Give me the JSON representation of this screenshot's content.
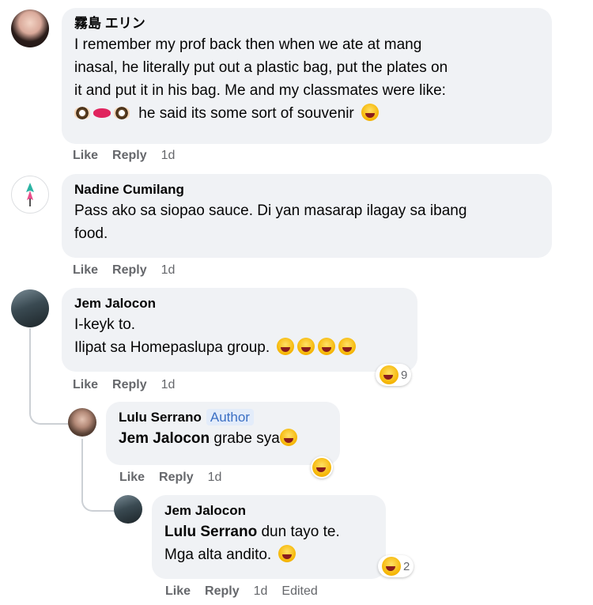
{
  "comments": [
    {
      "author": "霧島 エリン",
      "lines": [
        "I remember my prof back then when we ate at mang",
        "inasal, he literally put out a plastic bag, put the plates on",
        "it and put it in his bag. Me and my classmates were like:",
        "he said its some sort of souvenir"
      ],
      "actions": {
        "like": "Like",
        "reply": "Reply",
        "time": "1d"
      }
    },
    {
      "author": "Nadine Cumilang",
      "lines": [
        "Pass ako sa siopao sauce. Di yan masarap ilagay sa ibang",
        "food."
      ],
      "actions": {
        "like": "Like",
        "reply": "Reply",
        "time": "1d"
      }
    },
    {
      "author": "Jem Jalocon",
      "lines": [
        "I-keyk to.",
        "Ilipat sa Homepaslupa group."
      ],
      "reaction_count": "9",
      "actions": {
        "like": "Like",
        "reply": "Reply",
        "time": "1d"
      }
    },
    {
      "author": "Lulu Serrano",
      "badge": "Author",
      "mention": "Jem Jalocon",
      "text": "grabe sya",
      "actions": {
        "like": "Like",
        "reply": "Reply",
        "time": "1d"
      }
    },
    {
      "author": "Jem Jalocon",
      "mention": "Lulu Serrano",
      "text": "dun tayo te.",
      "line2": "Mga alta andito.",
      "reaction_count": "2",
      "actions": {
        "like": "Like",
        "reply": "Reply",
        "time": "1d",
        "edited": "Edited"
      }
    }
  ],
  "icons": {
    "laugh": "laughing-emoji-icon",
    "eyes": "eyes-emoji-icon",
    "lips": "lips-emoji-icon",
    "rofl": "rofl-emoji-icon"
  },
  "colors": {
    "bubble": "#f0f2f5",
    "meta": "#65676b",
    "badge": "#3b6fc4"
  }
}
